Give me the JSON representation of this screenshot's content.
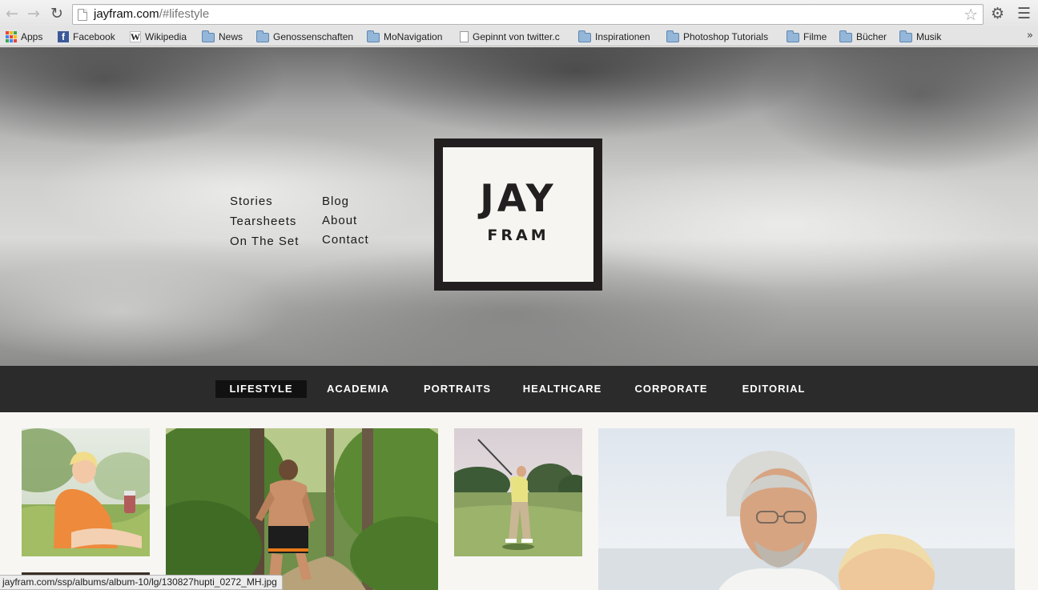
{
  "browser": {
    "url_host": "jayfram.com",
    "url_path": "/#lifestyle",
    "back_icon": "back-arrow-icon",
    "forward_icon": "forward-arrow-icon",
    "reload_icon": "reload-icon"
  },
  "bookmarks": [
    {
      "label": "Apps",
      "icon": "apps-grid-icon"
    },
    {
      "label": "Facebook",
      "icon": "facebook-icon"
    },
    {
      "label": "Wikipedia",
      "icon": "wikipedia-icon"
    },
    {
      "label": "News",
      "icon": "folder-icon"
    },
    {
      "label": "Genossenschaften",
      "icon": "folder-icon"
    },
    {
      "label": "MoNavigation",
      "icon": "folder-icon"
    },
    {
      "label": "Gepinnt von twitter.c",
      "icon": "document-icon"
    },
    {
      "label": "Inspirationen",
      "icon": "folder-icon"
    },
    {
      "label": "Photoshop Tutorials",
      "icon": "folder-icon"
    },
    {
      "label": "Filme",
      "icon": "folder-icon"
    },
    {
      "label": "Bücher",
      "icon": "folder-icon"
    },
    {
      "label": "Musik",
      "icon": "folder-icon"
    }
  ],
  "site": {
    "menu_left": [
      "Stories",
      "Tearsheets",
      "On The Set"
    ],
    "menu_right": [
      "Blog",
      "About",
      "Contact"
    ],
    "logo_line1": "JAY",
    "logo_line2": "FRAM"
  },
  "categories": [
    {
      "label": "LIFESTYLE",
      "active": true
    },
    {
      "label": "ACADEMIA",
      "active": false
    },
    {
      "label": "PORTRAITS",
      "active": false
    },
    {
      "label": "HEALTHCARE",
      "active": false
    },
    {
      "label": "CORPORATE",
      "active": false
    },
    {
      "label": "EDITORIAL",
      "active": false
    }
  ],
  "gallery": [
    {
      "subject": "woman-sitting-in-field-photo"
    },
    {
      "subject": "man-running-on-forest-trail-photo"
    },
    {
      "subject": "golfer-swinging-photo"
    },
    {
      "subject": "elderly-couple-portrait-photo"
    }
  ],
  "status_bar": "jayfram.com/ssp/albums/album-10/lg/130827hupti_0272_MH.jpg",
  "colors": {
    "category_bar": "#2b2b2b",
    "category_active": "#111111",
    "logo_border": "#231f20",
    "page_background": "#f7f6f2"
  }
}
